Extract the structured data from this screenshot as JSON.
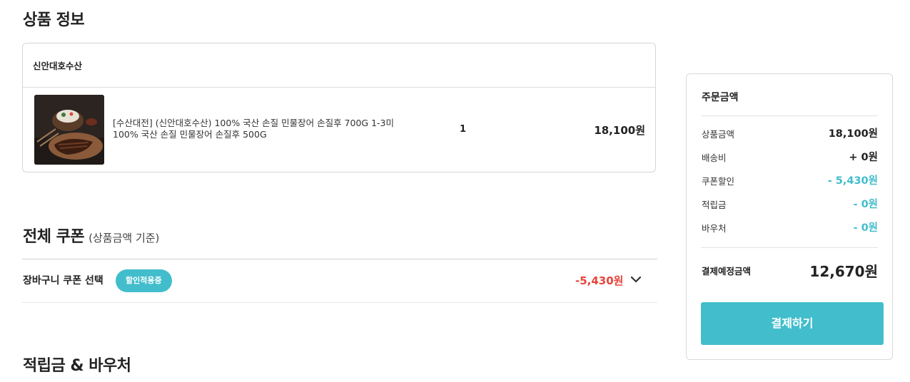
{
  "product_section": {
    "title": "상품 정보",
    "seller": "신안대호수산",
    "item": {
      "name_line1": "[수산대전] (신안대호수산) 100% 국산 손질 민물장어 손질후 700G 1-3미",
      "name_line2": "100% 국산 손질 민물장어 손질후 500G",
      "quantity": "1",
      "price": "18,100원"
    }
  },
  "coupon_section": {
    "title": "전체 쿠폰",
    "subtitle": "(상품금액 기준)",
    "cart_coupon_label": "장바구니 쿠폰 선택",
    "badge": "할인적용중",
    "amount": "-5,430원"
  },
  "points_section": {
    "title": "적립금 & 바우처"
  },
  "summary": {
    "title": "주문금액",
    "rows": [
      {
        "label": "상품금액",
        "value": "18,100원"
      },
      {
        "label": "배송비",
        "value": "+ 0원"
      },
      {
        "label": "쿠폰할인",
        "value": "- 5,430원"
      },
      {
        "label": "적립금",
        "value": "- 0원"
      },
      {
        "label": "바우처",
        "value": "- 0원"
      }
    ],
    "total_label": "결제예정금액",
    "total_value": "12,670원",
    "pay_button": "결제하기"
  },
  "colors": {
    "accent": "#42bdcc",
    "discount_red": "#e8453c"
  }
}
